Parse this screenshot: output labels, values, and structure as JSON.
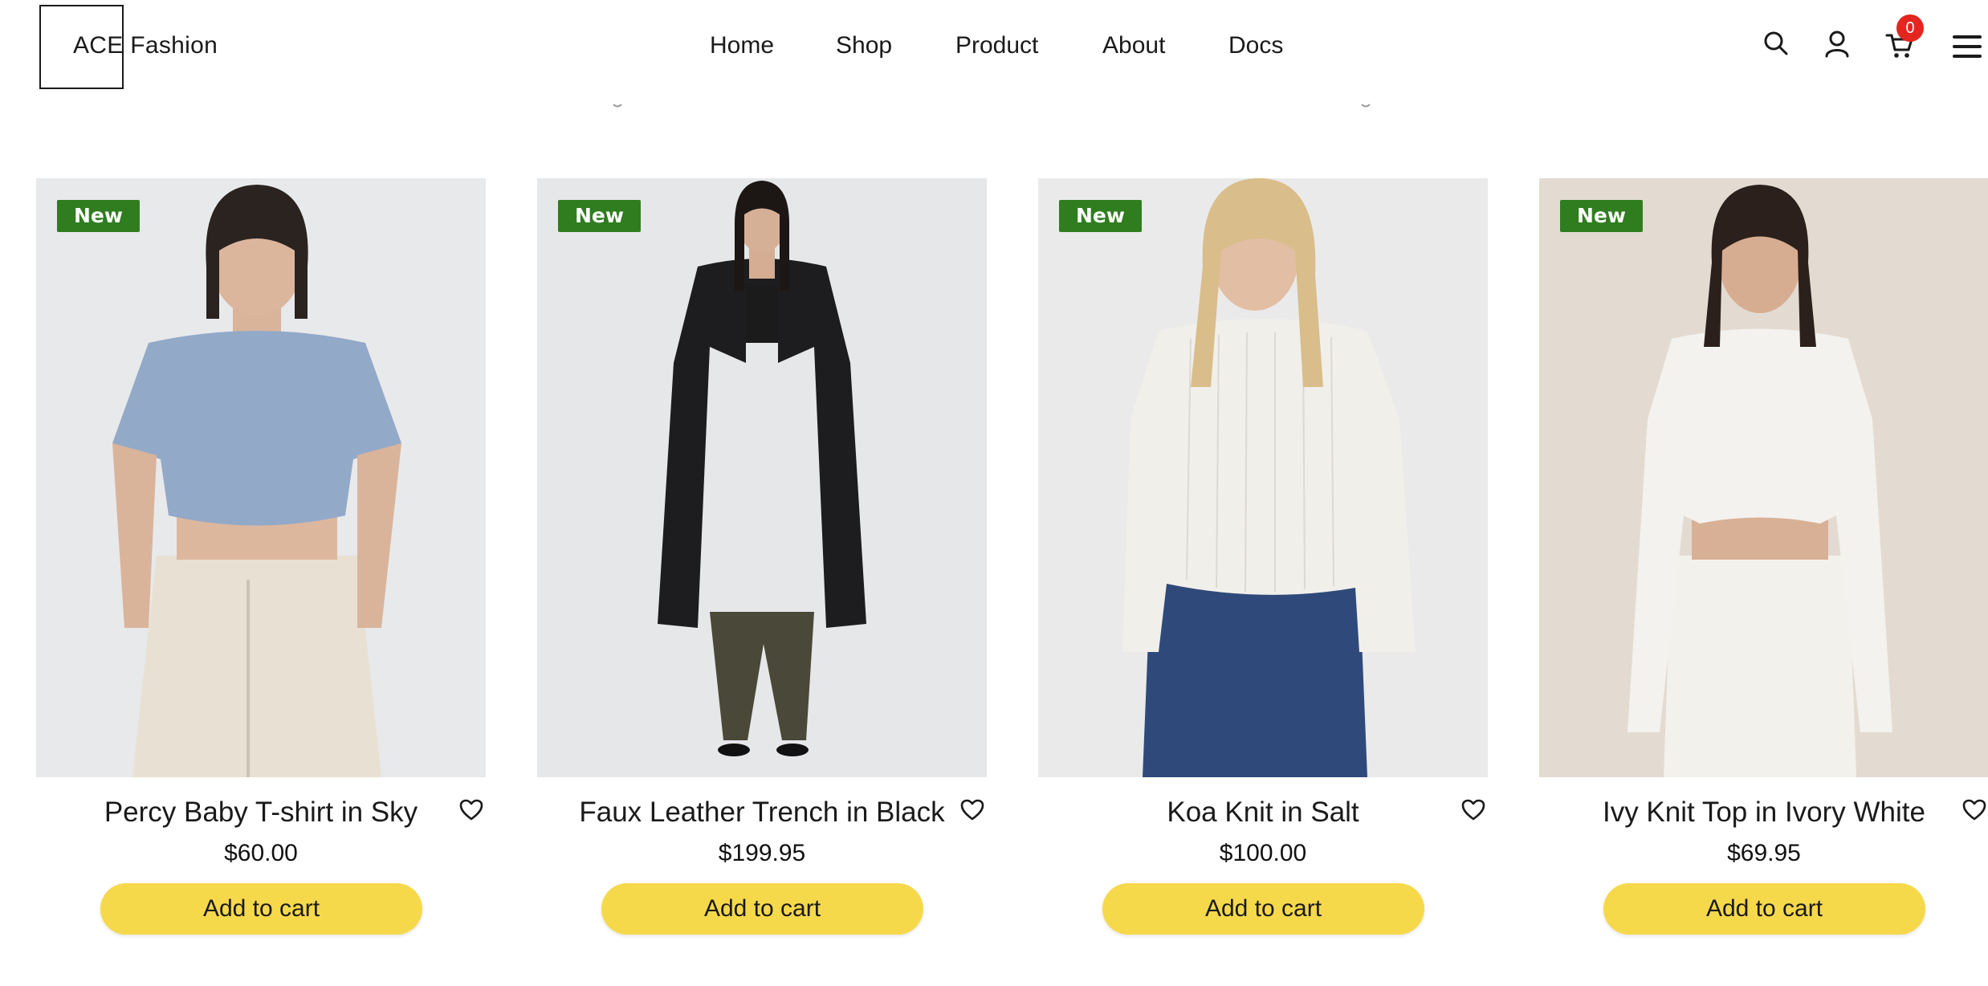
{
  "header": {
    "logo_text": "ACE Fashion",
    "nav": [
      "Home",
      "Shop",
      "Product",
      "About",
      "Docs"
    ],
    "cart_count": "0",
    "icons": [
      "search-icon",
      "user-icon",
      "cart-icon",
      "hamburger-menu-icon"
    ]
  },
  "colors": {
    "badge_new": "#2f7d1f",
    "add_to_cart": "#f6d94b",
    "cart_badge": "#e3261f"
  },
  "products": [
    {
      "name": "Percy Baby T-shirt in Sky",
      "price": "$60.00",
      "badge": "New",
      "cta": "Add to cart"
    },
    {
      "name": "Faux Leather Trench in Black",
      "price": "$199.95",
      "badge": "New",
      "cta": "Add to cart"
    },
    {
      "name": "Koa Knit in Salt",
      "price": "$100.00",
      "badge": "New",
      "cta": "Add to cart"
    },
    {
      "name": "Ivy Knit Top in Ivory White",
      "price": "$69.95",
      "badge": "New",
      "cta": "Add to cart"
    }
  ]
}
